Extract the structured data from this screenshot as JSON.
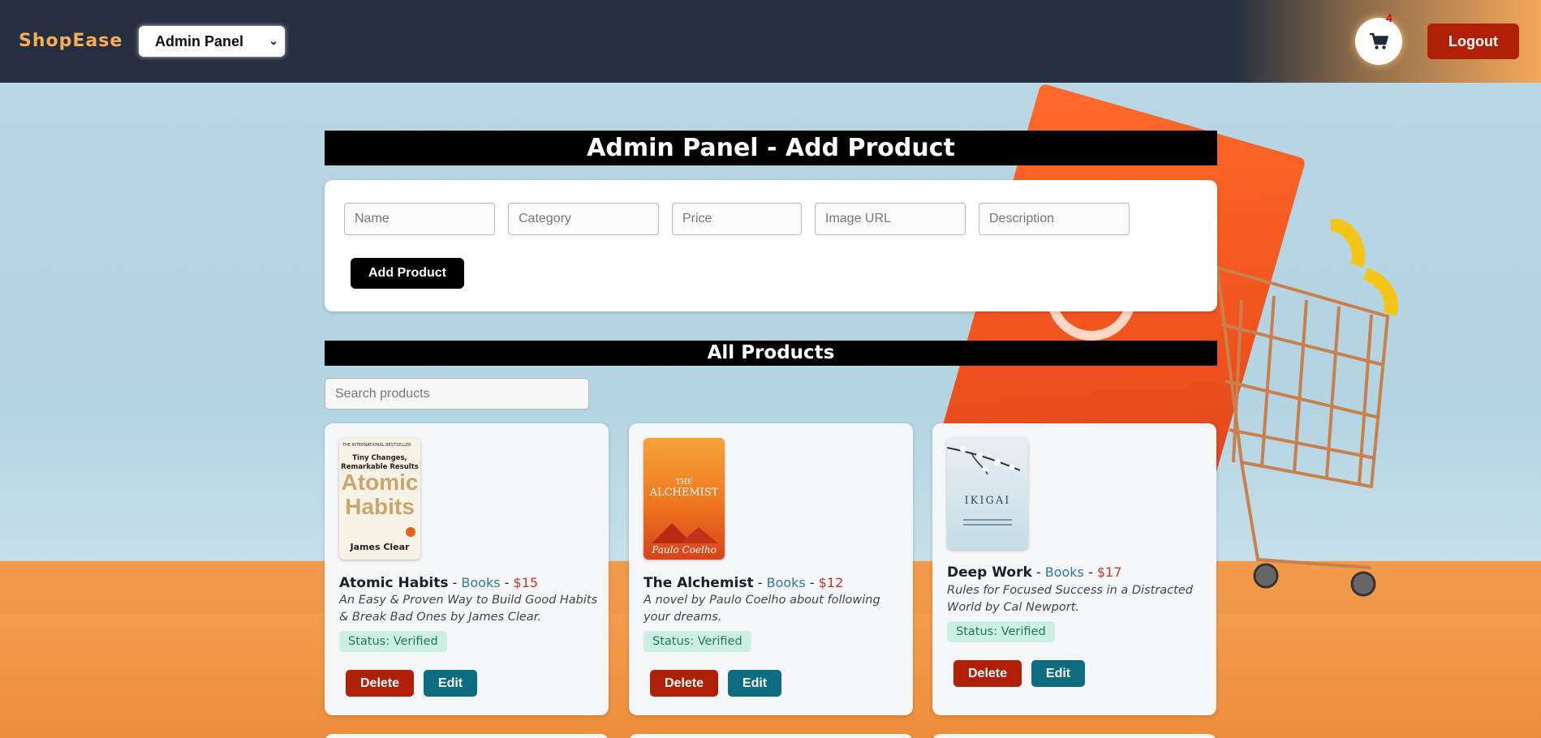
{
  "header": {
    "brand": "ShopEase",
    "panel_select": {
      "selected": "Admin Panel"
    },
    "cart_count": "4",
    "logout_label": "Logout"
  },
  "admin": {
    "title": "Admin Panel - Add Product",
    "placeholders": {
      "name": "Name",
      "category": "Category",
      "price": "Price",
      "image": "Image URL",
      "description": "Description"
    },
    "add_label": "Add Product"
  },
  "products_section": {
    "title": "All Products",
    "search_placeholder": "Search products",
    "items": [
      {
        "name": "Atomic Habits",
        "category": "Books",
        "price": "$15",
        "description": "An Easy & Proven Way to Build Good Habits & Break Bad Ones by James Clear.",
        "status": "Status: Verified",
        "cover": {
          "top": "THE INTERNATIONAL BESTSELLER",
          "tagline": "Tiny Changes, Remarkable Results",
          "title1": "Atomic",
          "title2": "Habits",
          "author": "James Clear"
        }
      },
      {
        "name": "The Alchemist",
        "category": "Books",
        "price": "$12",
        "description": "A novel by Paulo Coelho about following your dreams.",
        "status": "Status: Verified",
        "cover": {
          "title1": "THE",
          "title2": "ALCHEMIST",
          "author": "Paulo Coelho"
        }
      },
      {
        "name": "Deep Work",
        "category": "Books",
        "price": "$17",
        "description": "Rules for Focused Success in a Distracted World by Cal Newport.",
        "status": "Status: Verified",
        "cover": {
          "title1": "IKIGAI"
        }
      }
    ],
    "delete_label": "Delete",
    "edit_label": "Edit",
    "separator": " - "
  }
}
